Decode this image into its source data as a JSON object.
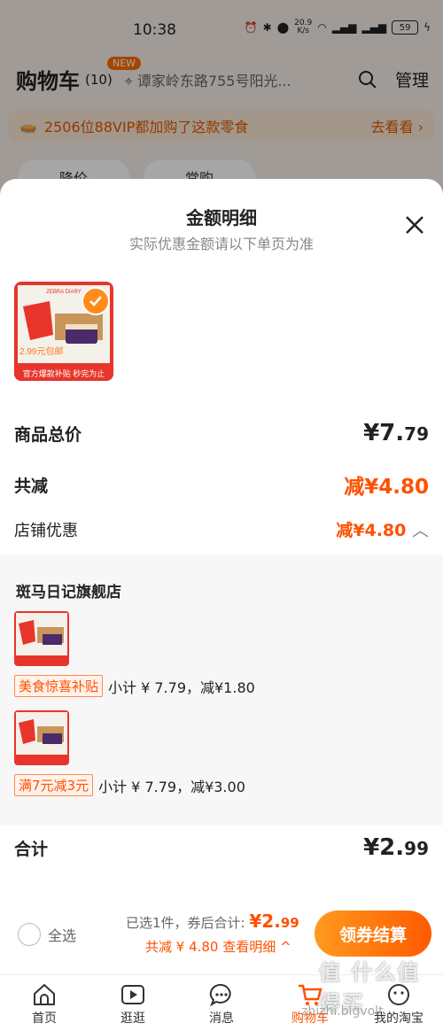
{
  "status": {
    "time": "10:38",
    "network": "20.9\nK/s",
    "battery": "59"
  },
  "cart": {
    "title": "购物车",
    "count": "(10)",
    "new_badge": "NEW",
    "address": "谭家岭东路755号阳光...",
    "manage": "管理",
    "vip_text": "2506位88VIP都加购了这款零食",
    "vip_link": "去看看 ›",
    "chips": [
      "降价",
      "常购"
    ]
  },
  "sheet": {
    "title": "金额明细",
    "subtitle": "实际优惠金额请以下单页为准",
    "product": {
      "brand": "ZEBRA DIARY",
      "price_tag": "2.99元包邮",
      "caption": "官方爆款补贴 秒完为止"
    },
    "total_label": "商品总价",
    "total_value_main": "¥7.",
    "total_value_dec": "79",
    "discount_label": "共减",
    "discount_value": "减¥4.80",
    "shop_discount_label": "店铺优惠",
    "shop_discount_value": "减¥4.80",
    "store_name": "斑马日记旗舰店",
    "items": [
      {
        "tag": "美食惊喜补贴",
        "text": "小计 ¥ 7.79，减¥1.80"
      },
      {
        "tag": "满7元减3元",
        "text": "小计 ¥ 7.79，减¥3.00"
      }
    ],
    "sum_label": "合计",
    "sum_value_main": "¥2.",
    "sum_value_dec": "99"
  },
  "checkout": {
    "select_all": "全选",
    "selected_text": "已选1件，券后合计: ",
    "amount_main": "¥2.",
    "amount_dec": "99",
    "discount_line": "共减 ¥ 4.80 查看明细 ^",
    "pay_button": "领券结算"
  },
  "tabs": [
    {
      "label": "首页",
      "icon": "home-icon"
    },
    {
      "label": "逛逛",
      "icon": "play-icon"
    },
    {
      "label": "消息",
      "icon": "message-icon"
    },
    {
      "label": "购物车",
      "icon": "cart-icon"
    },
    {
      "label": "我的淘宝",
      "icon": "profile-icon"
    }
  ],
  "watermark": "值 什么值得买",
  "watermark_small": "zhizhi.bigvolt"
}
